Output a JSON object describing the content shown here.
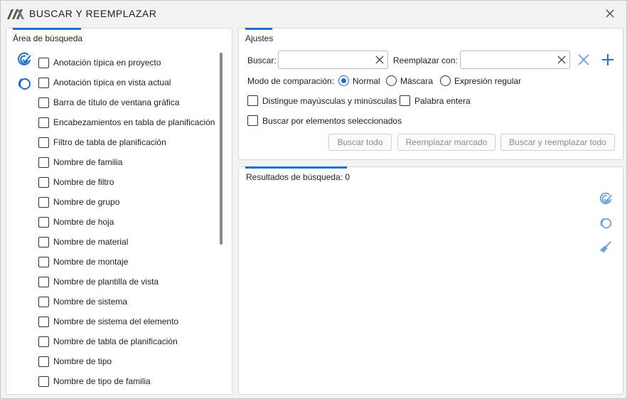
{
  "window": {
    "title": "BUSCAR Y REEMPLAZAR"
  },
  "colors": {
    "accent": "#1a6fd0",
    "icon_light": "#6aa0dc",
    "disabled_text": "#8c8c8c"
  },
  "search_area": {
    "title": "Área de búsqueda",
    "items": [
      {
        "label": "Anotación típica en proyecto",
        "checked": false
      },
      {
        "label": "Anotación típica en vista actual",
        "checked": false
      },
      {
        "label": "Barra de título de ventana gráfica",
        "checked": false
      },
      {
        "label": "Encabezamientos en tabla de planificación",
        "checked": false
      },
      {
        "label": "Filtro de tabla de planificación",
        "checked": false
      },
      {
        "label": "Nombre de familia",
        "checked": false
      },
      {
        "label": "Nombre de filtro",
        "checked": false
      },
      {
        "label": "Nombre de grupo",
        "checked": false
      },
      {
        "label": "Nombre de hoja",
        "checked": false
      },
      {
        "label": "Nombre de material",
        "checked": false
      },
      {
        "label": "Nombre de montaje",
        "checked": false
      },
      {
        "label": "Nombre de plantilla de vista",
        "checked": false
      },
      {
        "label": "Nombre de sistema",
        "checked": false
      },
      {
        "label": "Nombre de sistema del elemento",
        "checked": false
      },
      {
        "label": "Nombre de tabla de planificación",
        "checked": false
      },
      {
        "label": "Nombre de tipo",
        "checked": false
      },
      {
        "label": "Nombre de tipo de familia",
        "checked": false
      }
    ]
  },
  "settings": {
    "title": "Ajustes",
    "search_label": "Buscar:",
    "search_value": "",
    "replace_label": "Reemplazar con:",
    "replace_value": "",
    "mode_label": "Modo de comparación:",
    "modes": [
      {
        "label": "Normal",
        "selected": true
      },
      {
        "label": "Máscara",
        "selected": false
      },
      {
        "label": "Expresión regular",
        "selected": false
      }
    ],
    "match_case_label": "Distingue mayúsculas y minúsculas",
    "whole_word_label": "Palabra entera",
    "selected_only_label": "Buscar por elementos seleccionados",
    "buttons": {
      "find_all": "Buscar todo",
      "replace_marked": "Reemplazar marcado",
      "find_replace_all": "Buscar y reemplazar todo"
    }
  },
  "results": {
    "label": "Resultados de búsqueda: 0"
  }
}
